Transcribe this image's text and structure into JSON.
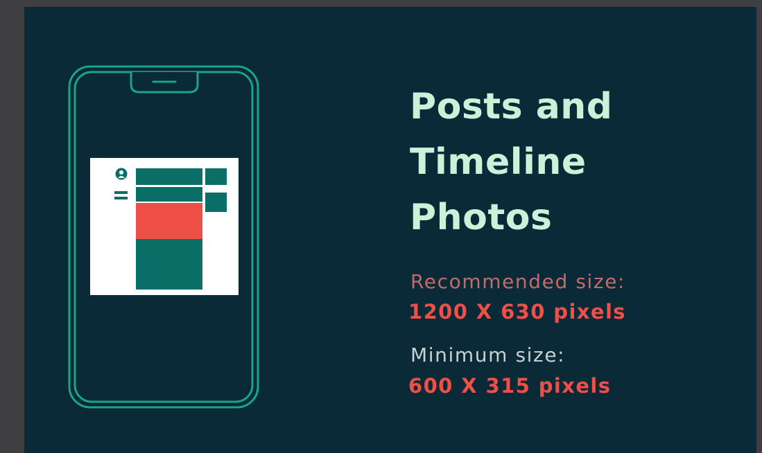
{
  "title": {
    "line1": "Posts and",
    "line2": "Timeline",
    "line3": "Photos"
  },
  "recommended": {
    "label": "Recommended size:",
    "value": "1200 X 630 pixels"
  },
  "minimum": {
    "label": "Minimum size:",
    "value": "600 X 315 pixels"
  },
  "colors": {
    "background": "#0b2a38",
    "outer": "#3f3f41",
    "phone_outline": "#1aa58a",
    "title": "#c9f3d8",
    "accent_red": "#ee4f47",
    "teal_block": "#0b6e67",
    "mockup_bg": "#ffffff"
  },
  "icons": {
    "phone": "smartphone-outline-icon",
    "avatar": "user-avatar-icon",
    "menu": "menu-lines-icon"
  }
}
